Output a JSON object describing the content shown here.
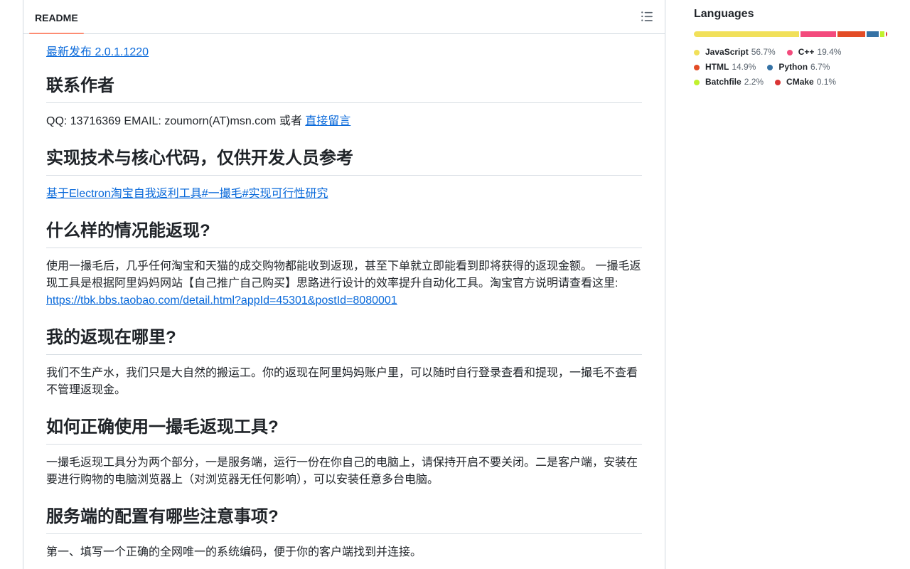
{
  "readme": {
    "tab_label": "README",
    "latest_release": "最新发布 2.0.1.1220",
    "sections": [
      {
        "heading": "联系作者",
        "paragraph_text": "QQ: 13716369 EMAIL: zoumorn(AT)msn.com 或者 ",
        "link": "直接留言"
      },
      {
        "heading": "实现技术与核心代码，仅供开发人员参考",
        "link": "基于Electron淘宝自我返利工具#一撮毛#实现可行性研究"
      },
      {
        "heading": "什么样的情况能返现?",
        "paragraph_text": "使用一撮毛后，几乎任何淘宝和天猫的成交购物都能收到返现，甚至下单就立即能看到即将获得的返现金额。 一撮毛返现工具是根据阿里妈妈网站【自己推广自己购买】思路进行设计的效率提升自动化工具。淘宝官方说明请查看这里: ",
        "link": "https://tbk.bbs.taobao.com/detail.html?appId=45301&postId=8080001"
      },
      {
        "heading": "我的返现在哪里?",
        "paragraph_text": "我们不生产水，我们只是大自然的搬运工。你的返现在阿里妈妈账户里，可以随时自行登录查看和提现，一撮毛不查看不管理返现金。"
      },
      {
        "heading": "如何正确使用一撮毛返现工具?",
        "paragraph_text": "一撮毛返现工具分为两个部分，一是服务端，运行一份在你自己的电脑上，请保持开启不要关闭。二是客户端，安装在要进行购物的电脑浏览器上（对浏览器无任何影响），可以安装任意多台电脑。"
      },
      {
        "heading": "服务端的配置有哪些注意事项?",
        "paragraph_text": "第一、填写一个正确的全网唯一的系统编码，便于你的客户端找到并连接。"
      }
    ]
  },
  "outline_icon": "list-unordered-icon",
  "languages": {
    "title": "Languages",
    "items": [
      {
        "name": "JavaScript",
        "percent": "56.7%",
        "share": 56.7,
        "color": "#f1e05a"
      },
      {
        "name": "C++",
        "percent": "19.4%",
        "share": 19.4,
        "color": "#f34b7d"
      },
      {
        "name": "HTML",
        "percent": "14.9%",
        "share": 14.9,
        "color": "#e34c26"
      },
      {
        "name": "Python",
        "percent": "6.7%",
        "share": 6.7,
        "color": "#3572A5"
      },
      {
        "name": "Batchfile",
        "percent": "2.2%",
        "share": 2.2,
        "color": "#C1F12E"
      },
      {
        "name": "CMake",
        "percent": "0.1%",
        "share": 0.1,
        "color": "#DA3434"
      }
    ]
  }
}
